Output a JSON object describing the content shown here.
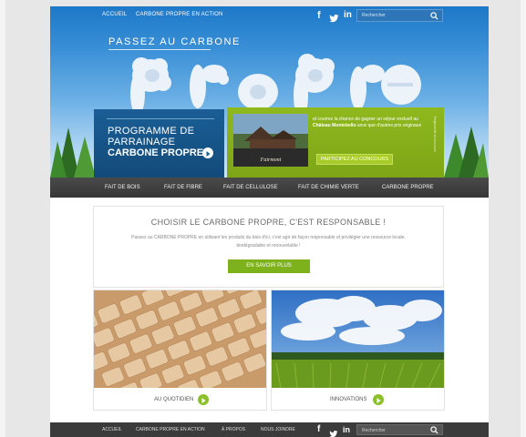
{
  "top_nav": {
    "links": [
      "ACCUEIL",
      "CARBONE PROPRE EN ACTION"
    ],
    "social": [
      "f",
      "t",
      "in"
    ],
    "search_placeholder": "Rechercher"
  },
  "hero": {
    "tagline": "PASSEZ AU CARBONE",
    "cloud_word": "PROPRE",
    "program": {
      "line1": "PROGRAMME DE",
      "line2": "PARRAINAGE",
      "line3": "CARBONE PROPRE"
    },
    "contest": {
      "photo_logo": "Fairmont",
      "desc_before": "et courrez la chance de gagner un séjour exclusif au",
      "desc_bold": "Château Montebello",
      "desc_after": "ainsi que d'autres prix originaux",
      "cta": "PARTICIPEZ AU CONCOURS",
      "side_text": "Règlements du concours"
    }
  },
  "main_nav": [
    "FAIT DE BOIS",
    "FAIT DE FIBRE",
    "FAIT DE CELLULOSE",
    "FAIT DE CHIMIE VERTE",
    "CARBONE PROPRE"
  ],
  "choose": {
    "heading": "CHOISIR LE CARBONE PROPRE, C'EST RESPONSABLE !",
    "paragraph": "Passez au CARBONE PROPRE en utilisant les produits du bois d'ici, c'est agir de façon responsable et privilégier une ressource locale, biodégradable et renouvelable !",
    "button": "EN SAVOIR PLUS"
  },
  "cards": [
    {
      "label": "AU QUOTIDIEN",
      "image": "wooden-keyboard"
    },
    {
      "label": "INNOVATIONS",
      "image": "corn-field-sky"
    }
  ],
  "footer": {
    "links": [
      "ACCUEIL",
      "CARBONE PROPRE EN ACTION",
      "À PROPOS",
      "NOUS JOINDRE"
    ],
    "social": [
      "f",
      "t",
      "in"
    ],
    "search_placeholder": "Rechercher"
  },
  "colors": {
    "sky_blue": "#1d78c8",
    "program_blue": "#134b7a",
    "contest_green": "#8fb81e",
    "button_green": "#7db21c",
    "nav_dark": "#3b3b3b"
  }
}
